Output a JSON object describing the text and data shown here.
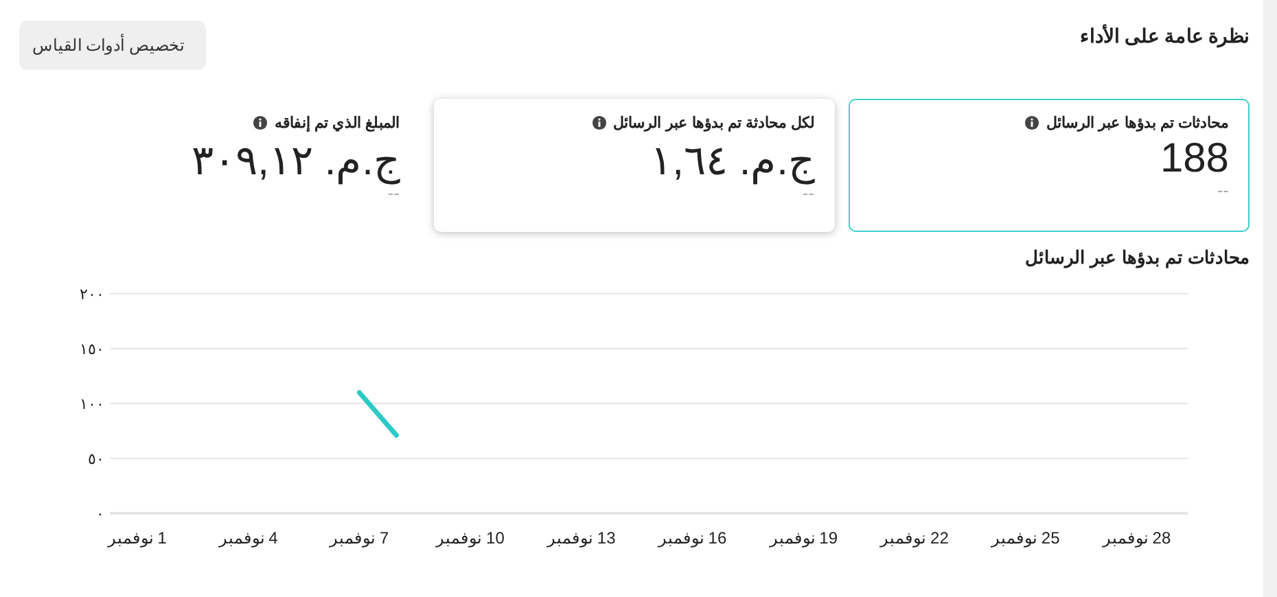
{
  "title": "نظرة عامة على الأداء",
  "customize_button": "تخصيص أدوات القياس",
  "cards": [
    {
      "label": "محادثات تم بدؤها عبر الرسائل",
      "value": "188",
      "change": "--",
      "selected": true,
      "hovered": false
    },
    {
      "label": "لكل محادثة تم بدؤها عبر الرسائل",
      "value": "ج.م. ١,٦٤",
      "change": "--",
      "selected": false,
      "hovered": true
    },
    {
      "label": "المبلغ الذي تم إنفاقه",
      "value": "ج.م. ٣٠٩,١٢",
      "change": "--",
      "selected": false,
      "hovered": false
    }
  ],
  "chart": {
    "title": "محادثات تم بدؤها عبر الرسائل",
    "chart_data": {
      "type": "line",
      "x": [
        7,
        8
      ],
      "series": [
        {
          "color": "#2ec9c4",
          "values": [
            110,
            71
          ]
        }
      ],
      "xlim": [
        0.26,
        29.38
      ],
      "ylim": [
        0,
        200
      ],
      "grid": true,
      "xticks": [
        {
          "value": 1,
          "label": "1 نوفمبر"
        },
        {
          "value": 4,
          "label": "4 نوفمبر"
        },
        {
          "value": 7,
          "label": "7 نوفمبر"
        },
        {
          "value": 10,
          "label": "10 نوفمبر"
        },
        {
          "value": 13,
          "label": "13 نوفمبر"
        },
        {
          "value": 16,
          "label": "16 نوفمبر"
        },
        {
          "value": 19,
          "label": "19 نوفمبر"
        },
        {
          "value": 22,
          "label": "22 نوفمبر"
        },
        {
          "value": 25,
          "label": "25 نوفمبر"
        },
        {
          "value": 28,
          "label": "28 نوفمبر"
        }
      ],
      "yticks": [
        {
          "value": 0,
          "label": "٠"
        },
        {
          "value": 50,
          "label": "٥٠"
        },
        {
          "value": 100,
          "label": "١٠٠"
        },
        {
          "value": 150,
          "label": "١٥٠"
        },
        {
          "value": 200,
          "label": "٢٠٠"
        }
      ]
    }
  }
}
